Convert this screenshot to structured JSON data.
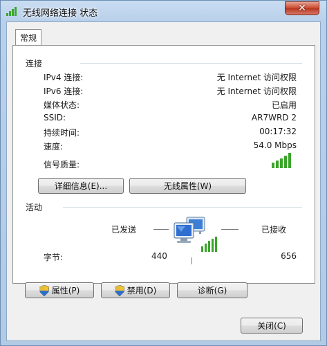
{
  "window": {
    "title": "无线网络连接 状态",
    "close_glyph": "✕"
  },
  "tab": {
    "label": "常规"
  },
  "connection": {
    "group_label": "连接",
    "rows": [
      {
        "label": "IPv4 连接:",
        "value": "无 Internet 访问权限"
      },
      {
        "label": "IPv6 连接:",
        "value": "无 Internet 访问权限"
      },
      {
        "label": "媒体状态:",
        "value": "已启用"
      },
      {
        "label": "SSID:",
        "value": "AR7WRD 2"
      },
      {
        "label": "持续时间:",
        "value": "00:17:32"
      },
      {
        "label": "速度:",
        "value": "54.0 Mbps"
      }
    ],
    "signal_label": "信号质量:",
    "signal_bars_lit": 5,
    "details_button": "详细信息(E)...",
    "wireless_props_button": "无线属性(W)"
  },
  "activity": {
    "group_label": "活动",
    "sent_label": "已发送",
    "received_label": "已接收",
    "bytes_label": "字节:",
    "bytes_sent": "440",
    "bytes_received": "656"
  },
  "buttons": {
    "properties": "属性(P)",
    "disable": "禁用(D)",
    "diagnose": "诊断(G)",
    "close": "关闭(C)"
  },
  "icons": {
    "title": "wireless-signal-icon",
    "shield": "uac-shield-icon",
    "network": "network-computers-icon"
  },
  "colors": {
    "signal_green": "#3aa52a",
    "title_bar": "#b9d0ea"
  }
}
